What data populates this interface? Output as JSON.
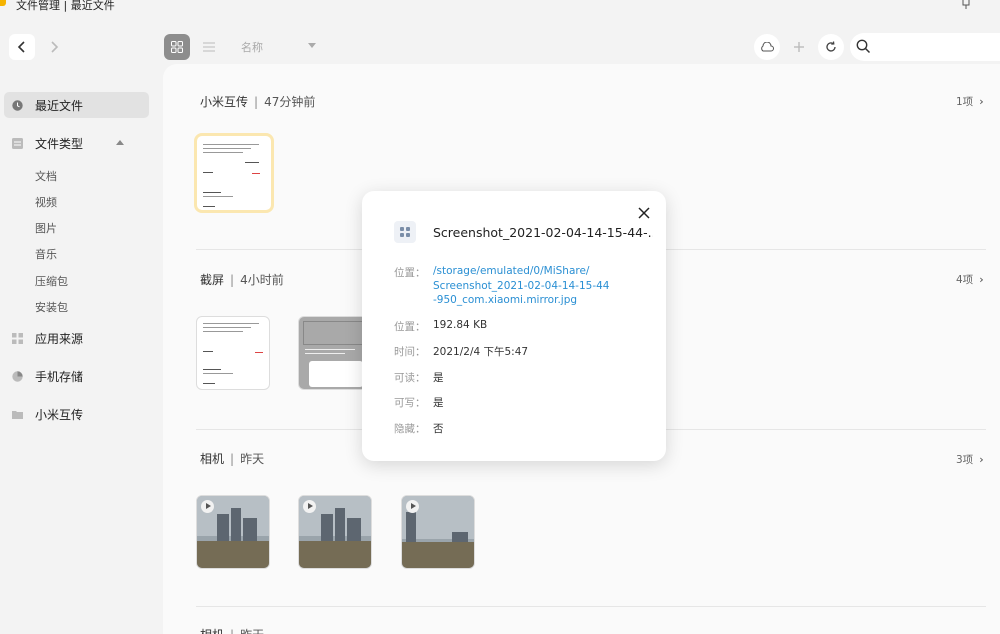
{
  "window": {
    "title": "文件管理 | 最近文件"
  },
  "toolbar": {
    "sort_label": "名称"
  },
  "sidebar": {
    "recent": "最近文件",
    "file_types": "文件类型",
    "sub_items": [
      "文档",
      "视频",
      "图片",
      "音乐",
      "压缩包",
      "安装包"
    ],
    "app_source": "应用来源",
    "phone_storage": "手机存储",
    "mi_transfer": "小米互传"
  },
  "sections": [
    {
      "name": "小米互传",
      "time": "47分钟前",
      "count": "1项"
    },
    {
      "name": "截屏",
      "time": "4小时前",
      "count": "4项"
    },
    {
      "name": "相机",
      "time": "昨天",
      "count": "3项"
    },
    {
      "name": "相机",
      "time": "昨天",
      "count": ""
    }
  ],
  "dialog": {
    "file_name": "Screenshot_2021-02-04-14-15-44-...",
    "location_label": "位置：",
    "location_value": "/storage/emulated/0/MiShare/ Screenshot_2021-02-04-14-15-44 -950_com.xiaomi.mirror.jpg",
    "size_label": "位置：",
    "size_value": "192.84 KB",
    "time_label": "时间：",
    "time_value": "2021/2/4 下午5:47",
    "readable_label": "可读：",
    "readable_value": "是",
    "writable_label": "可写：",
    "writable_value": "是",
    "hidden_label": "隐藏：",
    "hidden_value": "否"
  },
  "colors": {
    "accent": "#f5b300",
    "link": "#2a8fd3",
    "selected_border": "#fbe7b0"
  }
}
